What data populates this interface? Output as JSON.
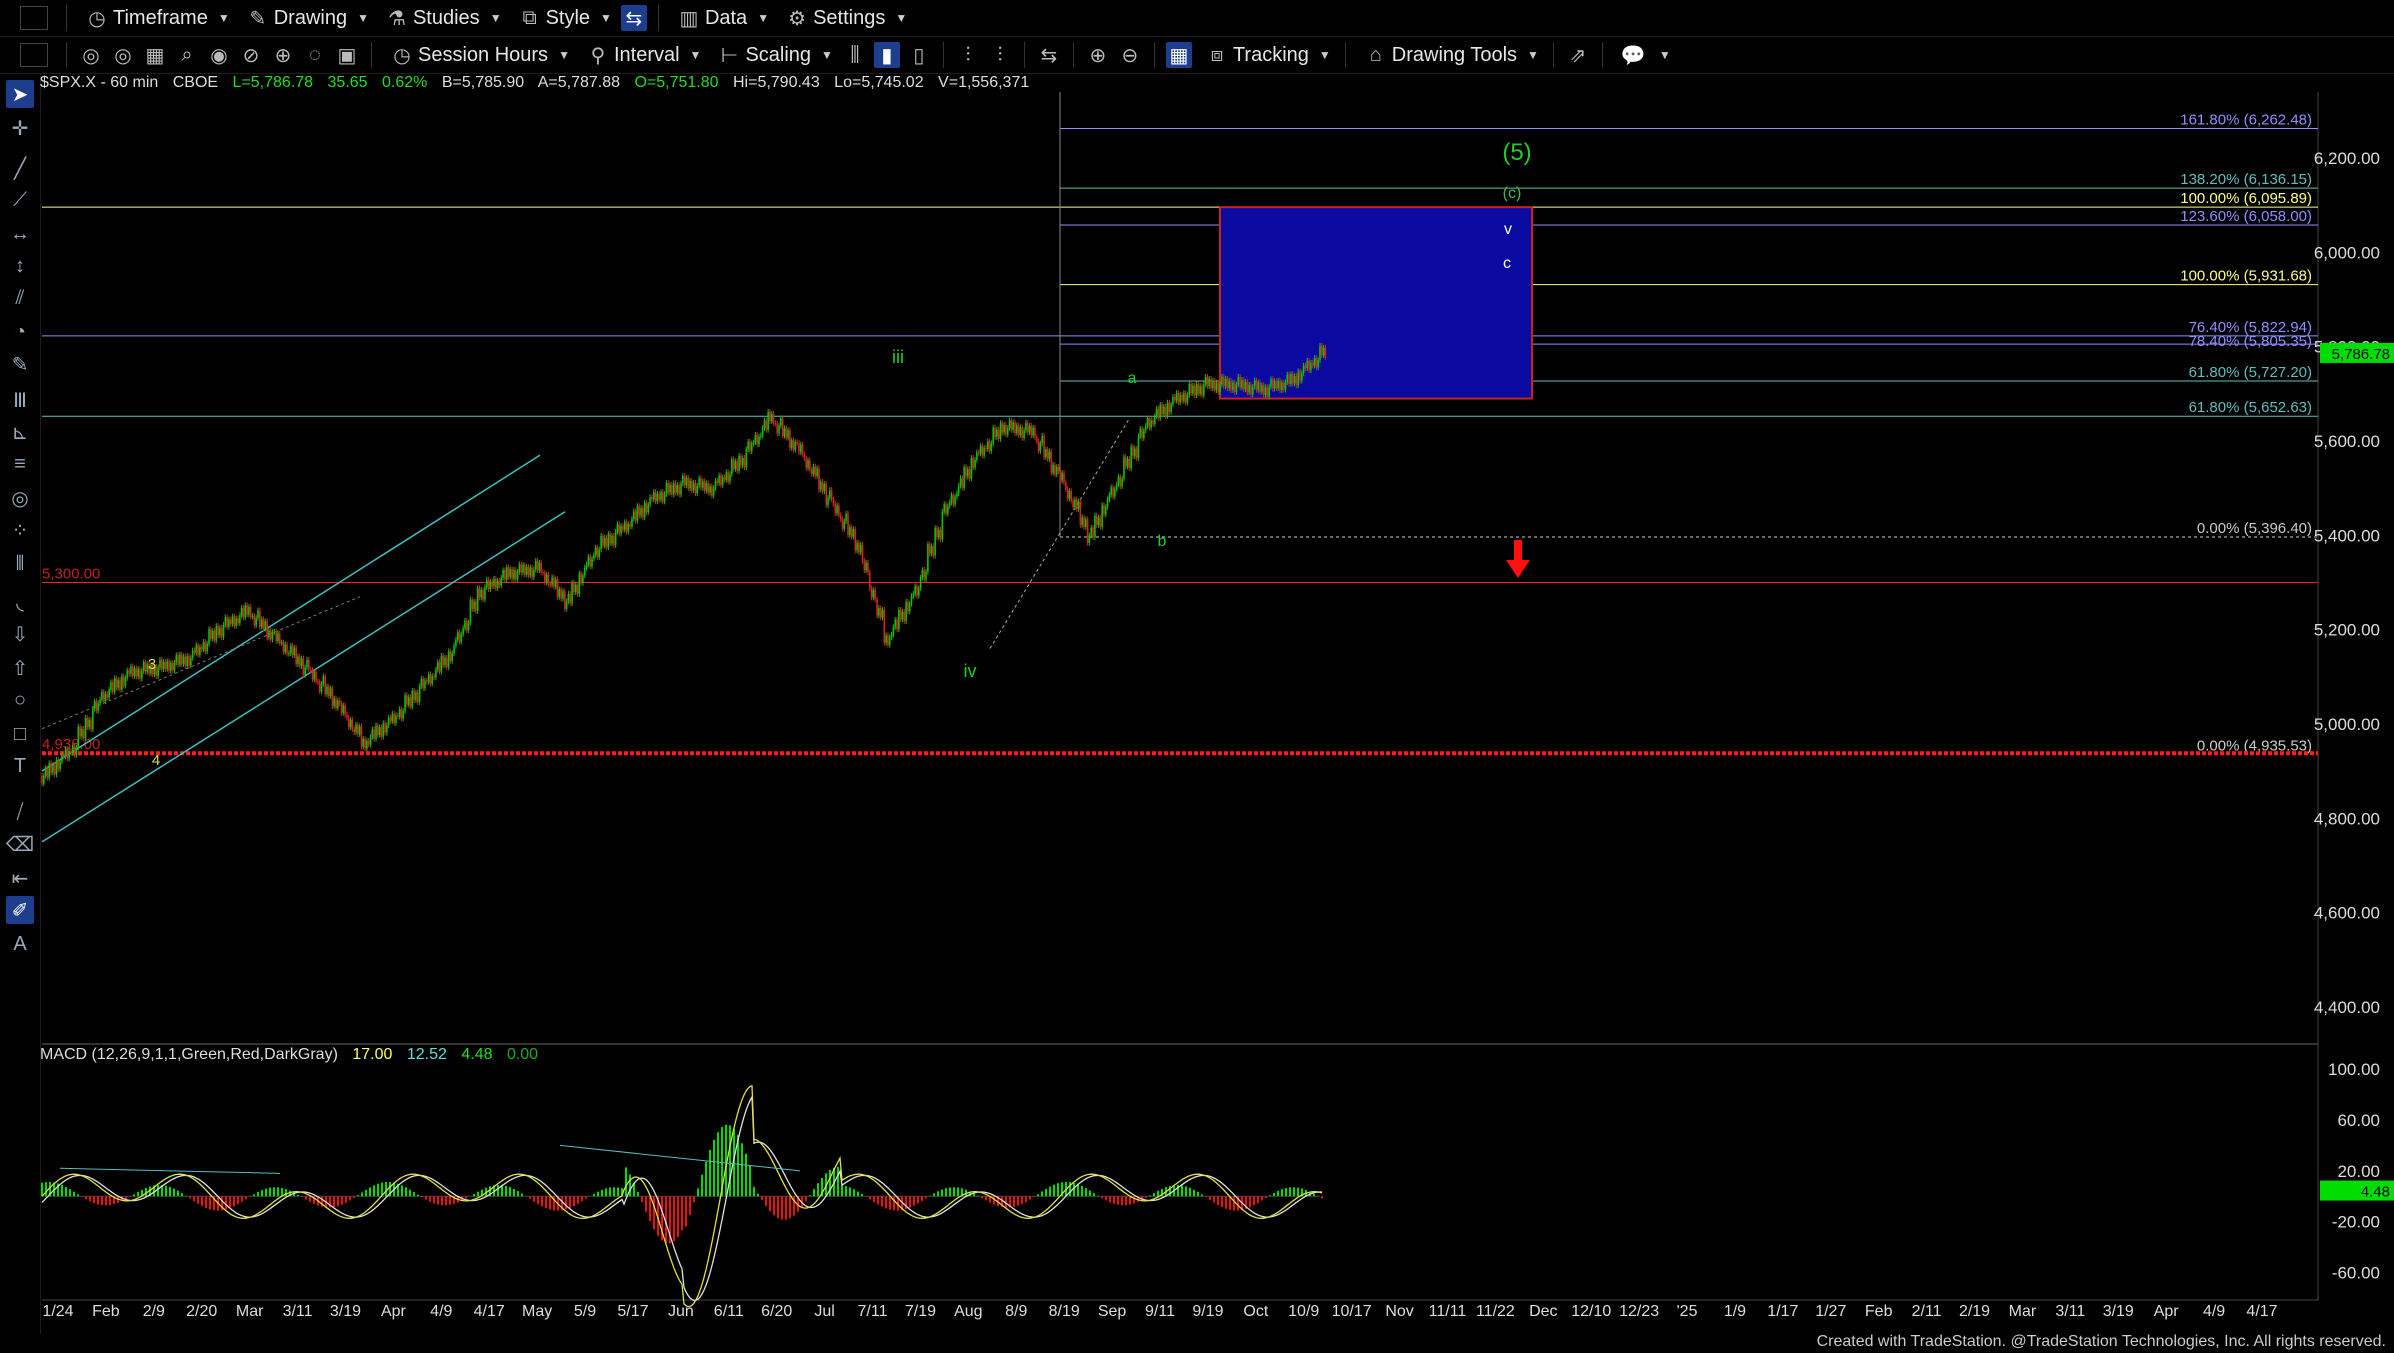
{
  "toolbar1": {
    "timeframe": "Timeframe",
    "drawing": "Drawing",
    "studies": "Studies",
    "style": "Style",
    "data": "Data",
    "settings": "Settings"
  },
  "toolbar2": {
    "session_hours": "Session Hours",
    "interval": "Interval",
    "scaling": "Scaling",
    "tracking": "Tracking",
    "drawing_tools": "Drawing Tools"
  },
  "header": {
    "symbol": "$SPX.X - 60 min",
    "exchange": "CBOE",
    "last": "L=5,786.78",
    "change": "35.65",
    "change_pct": "0.62%",
    "bid": "B=5,785.90",
    "ask": "A=5,787.88",
    "open": "O=5,751.80",
    "high": "Hi=5,790.43",
    "low": "Lo=5,745.02",
    "volume": "V=1,556,371"
  },
  "macd_header": {
    "label": "MACD (12,26,9,1,1,Green,Red,DarkGray)",
    "v1": "17.00",
    "v2": "12.52",
    "v3": "4.48",
    "v4": "0.00"
  },
  "colors": {
    "accent": "#1d3e8c",
    "up": "#00c800",
    "down": "#e02020",
    "price_label": "#00ff00",
    "fib_blue": "#8f8fff",
    "fib_yellow": "#ffff80",
    "fib_teal": "#5fbfbf",
    "support_red": "#ff2020",
    "wave_green": "#22cc22",
    "target_box": "#0a0aa0"
  },
  "icons": [
    "pointer-icon",
    "crosshair-icon",
    "trendline-icon",
    "zoom-in-icon",
    "zoom-out-icon",
    "tracking-icon",
    "drawing-tools-icon",
    "chart-icon"
  ],
  "chart_data": {
    "type": "candlestick",
    "title": "$SPX.X - 60 min",
    "price_axis": [
      "6,200.00",
      "6,000.00",
      "5,800.00",
      "5,600.00",
      "5,400.00",
      "5,200.00",
      "5,000.00",
      "4,800.00",
      "4,600.00",
      "4,400.00"
    ],
    "ylim": [
      4330,
      6340
    ],
    "last_price_label": "5,786.78",
    "date_axis": [
      "1/24",
      "Feb",
      "2/9",
      "2/20",
      "Mar",
      "3/11",
      "3/19",
      "Apr",
      "4/9",
      "4/17",
      "May",
      "5/9",
      "5/17",
      "Jun",
      "6/11",
      "6/20",
      "Jul",
      "7/11",
      "7/19",
      "Aug",
      "8/9",
      "8/19",
      "Sep",
      "9/11",
      "9/19",
      "Oct",
      "10/9",
      "10/17",
      "Nov",
      "11/11",
      "11/22",
      "Dec",
      "12/10",
      "12/23",
      "'25",
      "1/9",
      "1/17",
      "1/27",
      "Feb",
      "2/11",
      "2/19",
      "Mar",
      "3/11",
      "3/19",
      "Apr",
      "4/9",
      "4/17"
    ],
    "approx_path": [
      [
        0,
        4890
      ],
      [
        4,
        4950
      ],
      [
        8,
        5060
      ],
      [
        12,
        5110
      ],
      [
        16,
        5120
      ],
      [
        20,
        5140
      ],
      [
        24,
        5200
      ],
      [
        28,
        5240
      ],
      [
        32,
        5180
      ],
      [
        36,
        5120
      ],
      [
        40,
        5050
      ],
      [
        44,
        4960
      ],
      [
        48,
        5010
      ],
      [
        52,
        5080
      ],
      [
        56,
        5150
      ],
      [
        60,
        5280
      ],
      [
        64,
        5320
      ],
      [
        68,
        5330
      ],
      [
        72,
        5260
      ],
      [
        76,
        5370
      ],
      [
        80,
        5420
      ],
      [
        84,
        5480
      ],
      [
        88,
        5510
      ],
      [
        92,
        5500
      ],
      [
        96,
        5560
      ],
      [
        100,
        5650
      ],
      [
        104,
        5580
      ],
      [
        108,
        5480
      ],
      [
        112,
        5380
      ],
      [
        116,
        5180
      ],
      [
        120,
        5280
      ],
      [
        124,
        5450
      ],
      [
        128,
        5560
      ],
      [
        132,
        5630
      ],
      [
        136,
        5620
      ],
      [
        140,
        5520
      ],
      [
        144,
        5400
      ],
      [
        148,
        5520
      ],
      [
        152,
        5640
      ],
      [
        156,
        5690
      ],
      [
        160,
        5720
      ],
      [
        164,
        5720
      ],
      [
        168,
        5710
      ],
      [
        172,
        5730
      ],
      [
        176,
        5786
      ]
    ],
    "fib_levels": [
      {
        "label": "161.80% (6,262.48)",
        "value": 6262.48
      },
      {
        "label": "138.20% (6,136.15)",
        "value": 6136.15
      },
      {
        "label": "100.00% (6,095.89)",
        "value": 6095.89
      },
      {
        "label": "123.60% (6,058.00)",
        "value": 6058.0
      },
      {
        "label": "100.00% (5,931.68)",
        "value": 5931.68
      },
      {
        "label": "76.40% (5,822.94)",
        "value": 5822.94
      },
      {
        "label": "78.40% (5,805.35)",
        "value": 5805.35
      },
      {
        "label": "61.80% (5,727.20)",
        "value": 5727.2
      },
      {
        "label": "61.80% (5,652.63)",
        "value": 5652.63
      },
      {
        "label": "0.00% (5,396.40)",
        "value": 5396.4
      },
      {
        "label": "0.00% (4,935.53)",
        "value": 4935.53
      }
    ],
    "support_levels": [
      {
        "label": "5,300.00",
        "value": 5300
      },
      {
        "label": "4,938.00",
        "value": 4938
      }
    ],
    "target_box": {
      "low": 5690,
      "high": 6095.89
    },
    "wave_labels": [
      "(5)",
      "(c)",
      "v",
      "c",
      "iii",
      "a",
      "b",
      "iv",
      "3",
      "4"
    ],
    "macd_axis": [
      "100.00",
      "60.00",
      "20.00",
      "-20.00",
      "-60.00"
    ],
    "macd_last_label": "4.48",
    "macd_ylim": [
      -80,
      115
    ]
  },
  "footer": "Created with TradeStation. @TradeStation Technologies, Inc. All rights reserved."
}
